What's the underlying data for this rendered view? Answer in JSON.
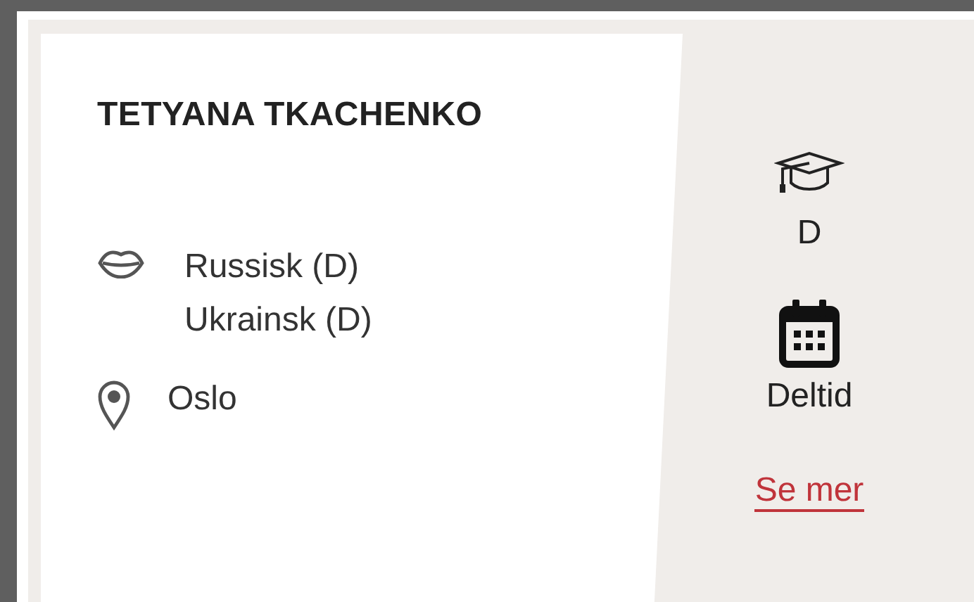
{
  "profile": {
    "name": "TETYANA TKACHENKO",
    "languages": [
      "Russisk (D)",
      "Ukrainsk (D)"
    ],
    "location": "Oslo"
  },
  "summary": {
    "education": "D",
    "schedule": "Deltid",
    "link": "Se mer"
  }
}
